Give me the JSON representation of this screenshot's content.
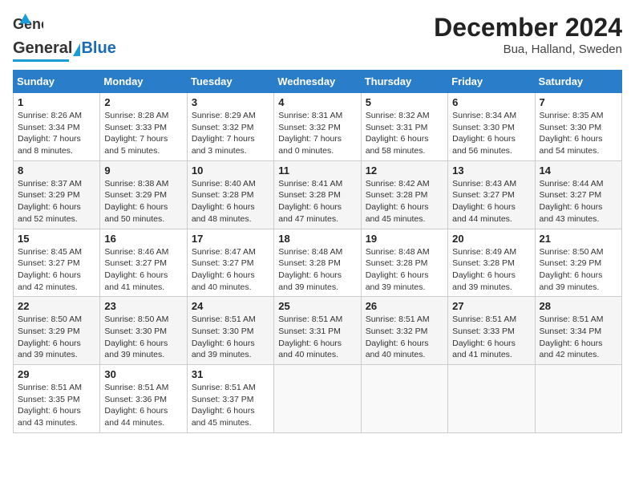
{
  "header": {
    "logo_general": "General",
    "logo_blue": "Blue",
    "month_title": "December 2024",
    "location": "Bua, Halland, Sweden"
  },
  "days_of_week": [
    "Sunday",
    "Monday",
    "Tuesday",
    "Wednesday",
    "Thursday",
    "Friday",
    "Saturday"
  ],
  "weeks": [
    [
      {
        "day": "1",
        "sunrise": "8:26 AM",
        "sunset": "3:34 PM",
        "daylight": "7 hours and 8 minutes."
      },
      {
        "day": "2",
        "sunrise": "8:28 AM",
        "sunset": "3:33 PM",
        "daylight": "7 hours and 5 minutes."
      },
      {
        "day": "3",
        "sunrise": "8:29 AM",
        "sunset": "3:32 PM",
        "daylight": "7 hours and 3 minutes."
      },
      {
        "day": "4",
        "sunrise": "8:31 AM",
        "sunset": "3:32 PM",
        "daylight": "7 hours and 0 minutes."
      },
      {
        "day": "5",
        "sunrise": "8:32 AM",
        "sunset": "3:31 PM",
        "daylight": "6 hours and 58 minutes."
      },
      {
        "day": "6",
        "sunrise": "8:34 AM",
        "sunset": "3:30 PM",
        "daylight": "6 hours and 56 minutes."
      },
      {
        "day": "7",
        "sunrise": "8:35 AM",
        "sunset": "3:30 PM",
        "daylight": "6 hours and 54 minutes."
      }
    ],
    [
      {
        "day": "8",
        "sunrise": "8:37 AM",
        "sunset": "3:29 PM",
        "daylight": "6 hours and 52 minutes."
      },
      {
        "day": "9",
        "sunrise": "8:38 AM",
        "sunset": "3:29 PM",
        "daylight": "6 hours and 50 minutes."
      },
      {
        "day": "10",
        "sunrise": "8:40 AM",
        "sunset": "3:28 PM",
        "daylight": "6 hours and 48 minutes."
      },
      {
        "day": "11",
        "sunrise": "8:41 AM",
        "sunset": "3:28 PM",
        "daylight": "6 hours and 47 minutes."
      },
      {
        "day": "12",
        "sunrise": "8:42 AM",
        "sunset": "3:28 PM",
        "daylight": "6 hours and 45 minutes."
      },
      {
        "day": "13",
        "sunrise": "8:43 AM",
        "sunset": "3:27 PM",
        "daylight": "6 hours and 44 minutes."
      },
      {
        "day": "14",
        "sunrise": "8:44 AM",
        "sunset": "3:27 PM",
        "daylight": "6 hours and 43 minutes."
      }
    ],
    [
      {
        "day": "15",
        "sunrise": "8:45 AM",
        "sunset": "3:27 PM",
        "daylight": "6 hours and 42 minutes."
      },
      {
        "day": "16",
        "sunrise": "8:46 AM",
        "sunset": "3:27 PM",
        "daylight": "6 hours and 41 minutes."
      },
      {
        "day": "17",
        "sunrise": "8:47 AM",
        "sunset": "3:27 PM",
        "daylight": "6 hours and 40 minutes."
      },
      {
        "day": "18",
        "sunrise": "8:48 AM",
        "sunset": "3:28 PM",
        "daylight": "6 hours and 39 minutes."
      },
      {
        "day": "19",
        "sunrise": "8:48 AM",
        "sunset": "3:28 PM",
        "daylight": "6 hours and 39 minutes."
      },
      {
        "day": "20",
        "sunrise": "8:49 AM",
        "sunset": "3:28 PM",
        "daylight": "6 hours and 39 minutes."
      },
      {
        "day": "21",
        "sunrise": "8:50 AM",
        "sunset": "3:29 PM",
        "daylight": "6 hours and 39 minutes."
      }
    ],
    [
      {
        "day": "22",
        "sunrise": "8:50 AM",
        "sunset": "3:29 PM",
        "daylight": "6 hours and 39 minutes."
      },
      {
        "day": "23",
        "sunrise": "8:50 AM",
        "sunset": "3:30 PM",
        "daylight": "6 hours and 39 minutes."
      },
      {
        "day": "24",
        "sunrise": "8:51 AM",
        "sunset": "3:30 PM",
        "daylight": "6 hours and 39 minutes."
      },
      {
        "day": "25",
        "sunrise": "8:51 AM",
        "sunset": "3:31 PM",
        "daylight": "6 hours and 40 minutes."
      },
      {
        "day": "26",
        "sunrise": "8:51 AM",
        "sunset": "3:32 PM",
        "daylight": "6 hours and 40 minutes."
      },
      {
        "day": "27",
        "sunrise": "8:51 AM",
        "sunset": "3:33 PM",
        "daylight": "6 hours and 41 minutes."
      },
      {
        "day": "28",
        "sunrise": "8:51 AM",
        "sunset": "3:34 PM",
        "daylight": "6 hours and 42 minutes."
      }
    ],
    [
      {
        "day": "29",
        "sunrise": "8:51 AM",
        "sunset": "3:35 PM",
        "daylight": "6 hours and 43 minutes."
      },
      {
        "day": "30",
        "sunrise": "8:51 AM",
        "sunset": "3:36 PM",
        "daylight": "6 hours and 44 minutes."
      },
      {
        "day": "31",
        "sunrise": "8:51 AM",
        "sunset": "3:37 PM",
        "daylight": "6 hours and 45 minutes."
      },
      null,
      null,
      null,
      null
    ]
  ],
  "labels": {
    "sunrise": "Sunrise:",
    "sunset": "Sunset:",
    "daylight": "Daylight:"
  }
}
